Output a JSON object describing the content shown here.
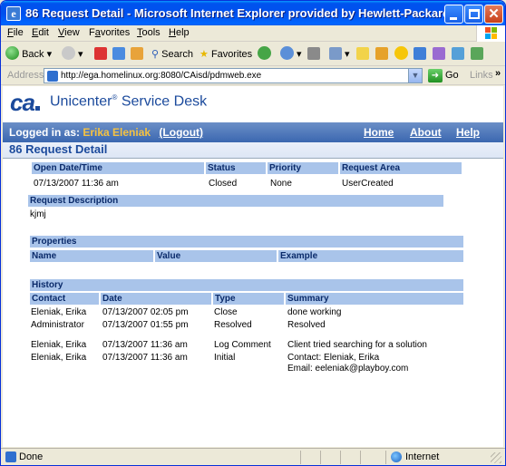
{
  "window": {
    "title": "86 Request Detail - Microsoft Internet Explorer provided by Hewlett-Packard",
    "app_icon": "ie-page-icon"
  },
  "menu": [
    {
      "label": "File",
      "underline": "F"
    },
    {
      "label": "Edit",
      "underline": "E"
    },
    {
      "label": "View",
      "underline": "V"
    },
    {
      "label": "Favorites",
      "underline": "a"
    },
    {
      "label": "Tools",
      "underline": "T"
    },
    {
      "label": "Help",
      "underline": "H"
    }
  ],
  "toolbar": {
    "back_label": "Back",
    "search_label": "Search",
    "favorites_label": "Favorites"
  },
  "address": {
    "label": "Address",
    "url": "http://ega.homelinux.org:8080/CAisd/pdmweb.exe",
    "go_label": "Go",
    "links_label": "Links"
  },
  "app": {
    "logo_text": "ca",
    "product_name": "Unicenter",
    "product_mark": "®",
    "product_suffix": " Service Desk"
  },
  "nav": {
    "logged_in_label": "Logged in as:",
    "user_name": "Erika Eleniak",
    "logout_label": "(Logout)",
    "home": "Home",
    "about": "About",
    "help": "Help"
  },
  "page": {
    "title": "86 Request Detail"
  },
  "summary": {
    "headers": [
      "Open Date/Time",
      "Status",
      "Priority",
      "Request Area"
    ],
    "values": [
      "07/13/2007 11:36 am",
      "Closed",
      "None",
      "UserCreated"
    ]
  },
  "description": {
    "header": "Request Description",
    "text": "kjmj"
  },
  "properties": {
    "section": "Properties",
    "headers": [
      "Name",
      "Value",
      "Example"
    ]
  },
  "history": {
    "section": "History",
    "headers": [
      "Contact",
      "Date",
      "Type",
      "Summary"
    ],
    "rows": [
      {
        "contact": "Eleniak, Erika",
        "date": "07/13/2007 02:05 pm",
        "type": "Close",
        "summary": "done working"
      },
      {
        "contact": "Administrator",
        "date": "07/13/2007 01:55 pm",
        "type": "Resolved",
        "summary": "Resolved"
      },
      {
        "contact": "Eleniak, Erika",
        "date": "07/13/2007 11:36 am",
        "type": "Log Comment",
        "summary": "Client tried searching for a solution"
      },
      {
        "contact": "Eleniak, Erika",
        "date": "07/13/2007 11:36 am",
        "type": "Initial",
        "summary": "Contact: Eleniak, Erika",
        "summary2": "Email: eeleniak@playboy.com"
      }
    ]
  },
  "status": {
    "text": "Done",
    "zone": "Internet"
  }
}
